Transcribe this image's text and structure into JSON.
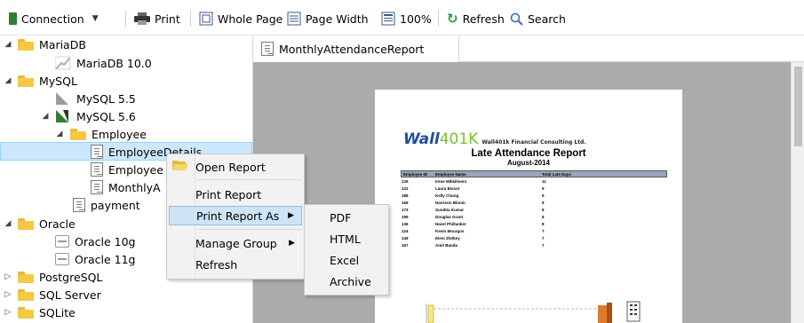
{
  "toolbar": {
    "connection": "Connection",
    "print": "Print",
    "whole_page": "Whole Page",
    "page_width": "Page Width",
    "zoom": "100%",
    "refresh": "Refresh",
    "search": "Search"
  },
  "tree": {
    "mariadb": "MariaDB",
    "mariadb_10": "MariaDB 10.0",
    "mysql": "MySQL",
    "mysql_55": "MySQL 5.5",
    "mysql_56": "MySQL 5.6",
    "employee": "Employee",
    "employee_details": "EmployeeDetails",
    "employee_partial": "Employee",
    "monthly_partial": "MonthlyA",
    "payment": "payment",
    "oracle": "Oracle",
    "oracle_10g": "Oracle 10g",
    "oracle_11g": "Oracle 11g",
    "postgresql": "PostgreSQL",
    "sqlserver": "SQL Server",
    "sqlite": "SQLite"
  },
  "tab": {
    "label": "MonthlyAttendanceReport"
  },
  "report": {
    "logo_main": "Wall",
    "logo_num": "401K",
    "logo_text": "Wall401k Financial Consulting Ltd.",
    "title": "Late Attendance Report",
    "subtitle": "August-2014",
    "columns": [
      "Employee ID",
      "Employee Name",
      "Total Late Days"
    ],
    "rows": [
      [
        "126",
        "Irene Mikkilineni",
        "11"
      ],
      [
        "122",
        "Laura Bissot",
        "9"
      ],
      [
        "188",
        "Kelly Chung",
        "9"
      ],
      [
        "169",
        "Harrison Bloom",
        "9"
      ],
      [
        "173",
        "Sundita Kumar",
        "8"
      ],
      [
        "199",
        "Douglas Grant",
        "8"
      ],
      [
        "136",
        "Hazel Philtanker",
        "8"
      ],
      [
        "124",
        "Kevin Mourgos",
        "7"
      ],
      [
        "149",
        "Eleni Zlotkey",
        "7"
      ],
      [
        "167",
        "Amit Banda",
        "7"
      ]
    ]
  },
  "context_menu": {
    "open_report": "Open Report",
    "print_report": "Print Report",
    "print_report_as": "Print Report As",
    "manage_group": "Manage Group",
    "refresh": "Refresh"
  },
  "submenu": {
    "pdf": "PDF",
    "html": "HTML",
    "excel": "Excel",
    "archive": "Archive"
  },
  "colors": {
    "selection": "#cce8ff",
    "folder": "#f4c842",
    "refresh_icon": "#2e9e3a",
    "logo_blue": "#1f4e9e",
    "logo_green": "#7cbf2b"
  }
}
